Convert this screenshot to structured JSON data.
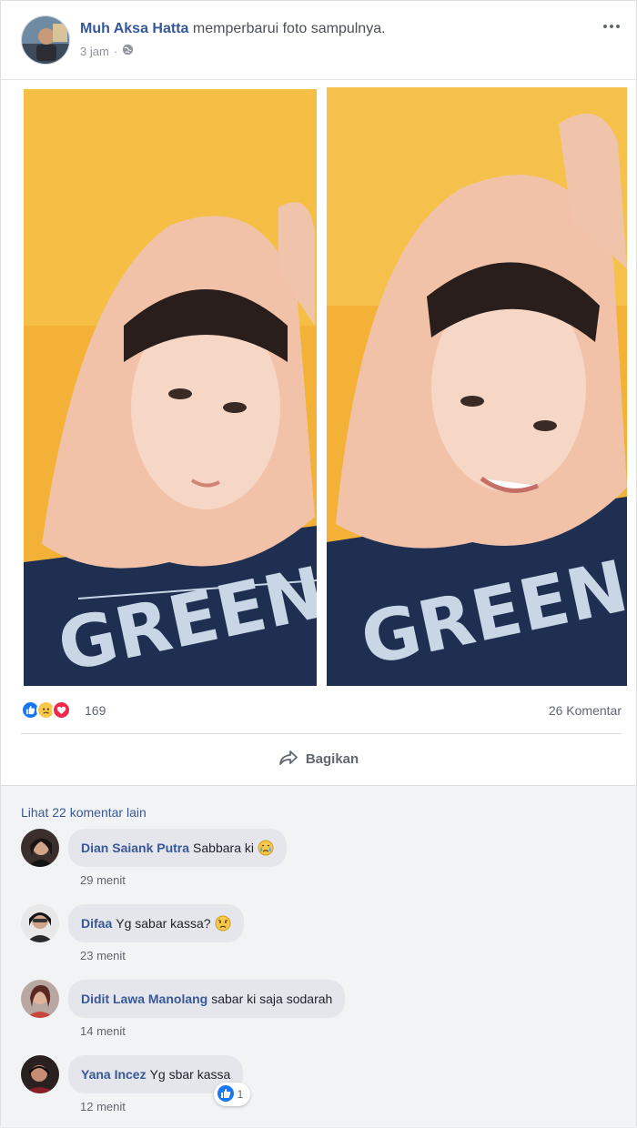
{
  "post": {
    "author": "Muh Aksa Hatta",
    "action": "memperbarui foto sampulnya.",
    "time": "3 jam",
    "privacy_icon": "globe-icon"
  },
  "photos": [
    {
      "name": "photo-left",
      "shirt_text": "GREEN"
    },
    {
      "name": "photo-right",
      "shirt_text": "GREEN"
    }
  ],
  "stats": {
    "reactions": [
      "like",
      "sad",
      "love"
    ],
    "reaction_count": "169",
    "comment_count": "26 Komentar"
  },
  "actions": {
    "share_label": "Bagikan"
  },
  "comments": {
    "more_label": "Lihat 22 komentar lain",
    "items": [
      {
        "name": "Dian Saiank Putra",
        "text": "Sabbara ki",
        "emoji": "crying-face",
        "time": "29 menit"
      },
      {
        "name": "Difaa",
        "text": "Yg sabar kassa?",
        "emoji": "worried-face",
        "time": "23 menit"
      },
      {
        "name": "Didit Lawa Manolang",
        "text": "sabar ki saja sodarah",
        "emoji": "",
        "time": "14 menit"
      },
      {
        "name": "Yana Incez",
        "text": "Yg sbar kassa",
        "emoji": "",
        "time": "12 menit",
        "likes": "1"
      }
    ]
  },
  "colors": {
    "link": "#385898",
    "background": "#ffffff",
    "comment_bubble": "#e4e6eb",
    "photo_wall": "#f3b237",
    "hijab": "#f2c2a8",
    "shirt": "#1f2f52"
  }
}
